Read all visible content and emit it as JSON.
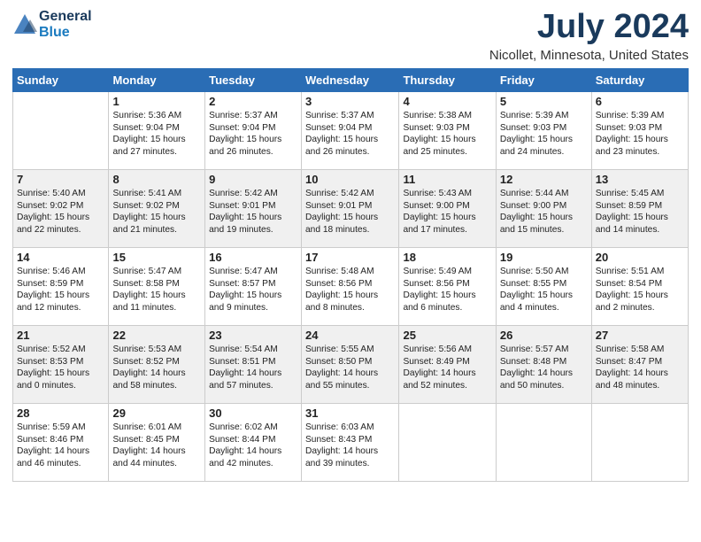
{
  "logo": {
    "general": "General",
    "blue": "Blue"
  },
  "title": "July 2024",
  "subtitle": "Nicollet, Minnesota, United States",
  "weekdays": [
    "Sunday",
    "Monday",
    "Tuesday",
    "Wednesday",
    "Thursday",
    "Friday",
    "Saturday"
  ],
  "weeks": [
    [
      {
        "day": "",
        "sunrise": "",
        "sunset": "",
        "daylight": ""
      },
      {
        "day": "1",
        "sunrise": "Sunrise: 5:36 AM",
        "sunset": "Sunset: 9:04 PM",
        "daylight": "Daylight: 15 hours and 27 minutes."
      },
      {
        "day": "2",
        "sunrise": "Sunrise: 5:37 AM",
        "sunset": "Sunset: 9:04 PM",
        "daylight": "Daylight: 15 hours and 26 minutes."
      },
      {
        "day": "3",
        "sunrise": "Sunrise: 5:37 AM",
        "sunset": "Sunset: 9:04 PM",
        "daylight": "Daylight: 15 hours and 26 minutes."
      },
      {
        "day": "4",
        "sunrise": "Sunrise: 5:38 AM",
        "sunset": "Sunset: 9:03 PM",
        "daylight": "Daylight: 15 hours and 25 minutes."
      },
      {
        "day": "5",
        "sunrise": "Sunrise: 5:39 AM",
        "sunset": "Sunset: 9:03 PM",
        "daylight": "Daylight: 15 hours and 24 minutes."
      },
      {
        "day": "6",
        "sunrise": "Sunrise: 5:39 AM",
        "sunset": "Sunset: 9:03 PM",
        "daylight": "Daylight: 15 hours and 23 minutes."
      }
    ],
    [
      {
        "day": "7",
        "sunrise": "Sunrise: 5:40 AM",
        "sunset": "Sunset: 9:02 PM",
        "daylight": "Daylight: 15 hours and 22 minutes."
      },
      {
        "day": "8",
        "sunrise": "Sunrise: 5:41 AM",
        "sunset": "Sunset: 9:02 PM",
        "daylight": "Daylight: 15 hours and 21 minutes."
      },
      {
        "day": "9",
        "sunrise": "Sunrise: 5:42 AM",
        "sunset": "Sunset: 9:01 PM",
        "daylight": "Daylight: 15 hours and 19 minutes."
      },
      {
        "day": "10",
        "sunrise": "Sunrise: 5:42 AM",
        "sunset": "Sunset: 9:01 PM",
        "daylight": "Daylight: 15 hours and 18 minutes."
      },
      {
        "day": "11",
        "sunrise": "Sunrise: 5:43 AM",
        "sunset": "Sunset: 9:00 PM",
        "daylight": "Daylight: 15 hours and 17 minutes."
      },
      {
        "day": "12",
        "sunrise": "Sunrise: 5:44 AM",
        "sunset": "Sunset: 9:00 PM",
        "daylight": "Daylight: 15 hours and 15 minutes."
      },
      {
        "day": "13",
        "sunrise": "Sunrise: 5:45 AM",
        "sunset": "Sunset: 8:59 PM",
        "daylight": "Daylight: 15 hours and 14 minutes."
      }
    ],
    [
      {
        "day": "14",
        "sunrise": "Sunrise: 5:46 AM",
        "sunset": "Sunset: 8:59 PM",
        "daylight": "Daylight: 15 hours and 12 minutes."
      },
      {
        "day": "15",
        "sunrise": "Sunrise: 5:47 AM",
        "sunset": "Sunset: 8:58 PM",
        "daylight": "Daylight: 15 hours and 11 minutes."
      },
      {
        "day": "16",
        "sunrise": "Sunrise: 5:47 AM",
        "sunset": "Sunset: 8:57 PM",
        "daylight": "Daylight: 15 hours and 9 minutes."
      },
      {
        "day": "17",
        "sunrise": "Sunrise: 5:48 AM",
        "sunset": "Sunset: 8:56 PM",
        "daylight": "Daylight: 15 hours and 8 minutes."
      },
      {
        "day": "18",
        "sunrise": "Sunrise: 5:49 AM",
        "sunset": "Sunset: 8:56 PM",
        "daylight": "Daylight: 15 hours and 6 minutes."
      },
      {
        "day": "19",
        "sunrise": "Sunrise: 5:50 AM",
        "sunset": "Sunset: 8:55 PM",
        "daylight": "Daylight: 15 hours and 4 minutes."
      },
      {
        "day": "20",
        "sunrise": "Sunrise: 5:51 AM",
        "sunset": "Sunset: 8:54 PM",
        "daylight": "Daylight: 15 hours and 2 minutes."
      }
    ],
    [
      {
        "day": "21",
        "sunrise": "Sunrise: 5:52 AM",
        "sunset": "Sunset: 8:53 PM",
        "daylight": "Daylight: 15 hours and 0 minutes."
      },
      {
        "day": "22",
        "sunrise": "Sunrise: 5:53 AM",
        "sunset": "Sunset: 8:52 PM",
        "daylight": "Daylight: 14 hours and 58 minutes."
      },
      {
        "day": "23",
        "sunrise": "Sunrise: 5:54 AM",
        "sunset": "Sunset: 8:51 PM",
        "daylight": "Daylight: 14 hours and 57 minutes."
      },
      {
        "day": "24",
        "sunrise": "Sunrise: 5:55 AM",
        "sunset": "Sunset: 8:50 PM",
        "daylight": "Daylight: 14 hours and 55 minutes."
      },
      {
        "day": "25",
        "sunrise": "Sunrise: 5:56 AM",
        "sunset": "Sunset: 8:49 PM",
        "daylight": "Daylight: 14 hours and 52 minutes."
      },
      {
        "day": "26",
        "sunrise": "Sunrise: 5:57 AM",
        "sunset": "Sunset: 8:48 PM",
        "daylight": "Daylight: 14 hours and 50 minutes."
      },
      {
        "day": "27",
        "sunrise": "Sunrise: 5:58 AM",
        "sunset": "Sunset: 8:47 PM",
        "daylight": "Daylight: 14 hours and 48 minutes."
      }
    ],
    [
      {
        "day": "28",
        "sunrise": "Sunrise: 5:59 AM",
        "sunset": "Sunset: 8:46 PM",
        "daylight": "Daylight: 14 hours and 46 minutes."
      },
      {
        "day": "29",
        "sunrise": "Sunrise: 6:01 AM",
        "sunset": "Sunset: 8:45 PM",
        "daylight": "Daylight: 14 hours and 44 minutes."
      },
      {
        "day": "30",
        "sunrise": "Sunrise: 6:02 AM",
        "sunset": "Sunset: 8:44 PM",
        "daylight": "Daylight: 14 hours and 42 minutes."
      },
      {
        "day": "31",
        "sunrise": "Sunrise: 6:03 AM",
        "sunset": "Sunset: 8:43 PM",
        "daylight": "Daylight: 14 hours and 39 minutes."
      },
      {
        "day": "",
        "sunrise": "",
        "sunset": "",
        "daylight": ""
      },
      {
        "day": "",
        "sunrise": "",
        "sunset": "",
        "daylight": ""
      },
      {
        "day": "",
        "sunrise": "",
        "sunset": "",
        "daylight": ""
      }
    ]
  ]
}
